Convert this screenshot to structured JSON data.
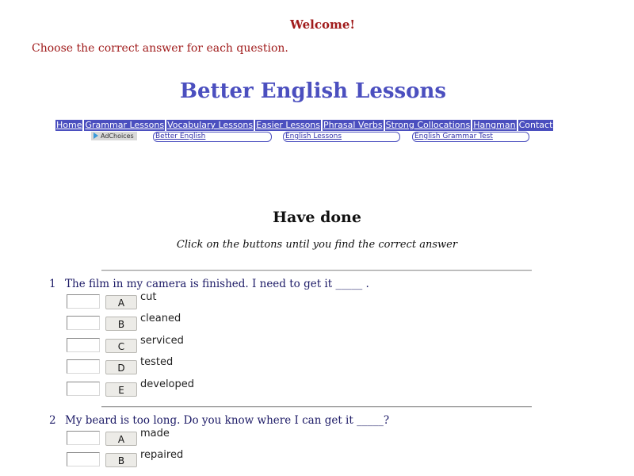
{
  "header": {
    "welcome": "Welcome!",
    "instruction": "Choose the correct answer for each question.",
    "site_title": "Better English Lessons"
  },
  "nav": [
    "Home",
    "Grammar Lessons",
    "Vocabulary Lessons",
    "Easier Lessons",
    "Phrasal Verbs",
    "Strong Collocations",
    "Hangman",
    "Contact"
  ],
  "ads": {
    "adchoices_label": "AdChoices",
    "links": [
      "Better English",
      "English Lessons",
      "English Grammar Test"
    ]
  },
  "exercise": {
    "title": "Have done",
    "subtitle": "Click on the buttons until you find the correct answer"
  },
  "questions": [
    {
      "number": "1",
      "text": "The film in my camera is finished. I need to get it _____ .",
      "options": [
        {
          "letter": "A",
          "text": "cut"
        },
        {
          "letter": "B",
          "text": "cleaned"
        },
        {
          "letter": "C",
          "text": "serviced"
        },
        {
          "letter": "D",
          "text": "tested"
        },
        {
          "letter": "E",
          "text": "developed"
        }
      ]
    },
    {
      "number": "2",
      "text": "My beard is too long. Do you know where I can get it _____?",
      "options": [
        {
          "letter": "A",
          "text": "made"
        },
        {
          "letter": "B",
          "text": "repaired"
        }
      ]
    }
  ]
}
